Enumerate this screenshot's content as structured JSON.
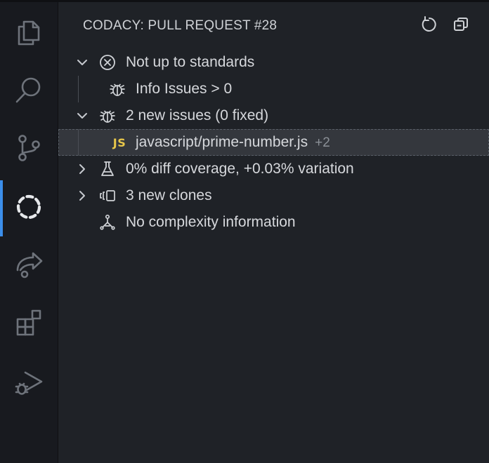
{
  "activity_bar": {
    "items": [
      {
        "name": "explorer",
        "icon": "files-icon"
      },
      {
        "name": "search",
        "icon": "search-icon"
      },
      {
        "name": "source-control",
        "icon": "source-control-icon"
      },
      {
        "name": "codacy",
        "icon": "codacy-icon",
        "active": true
      },
      {
        "name": "remote",
        "icon": "remote-share-icon"
      },
      {
        "name": "extensions",
        "icon": "extensions-icon"
      },
      {
        "name": "run-debug",
        "icon": "run-debug-icon"
      }
    ],
    "accent_color": "#3b8eea"
  },
  "panel": {
    "title": "CODACY: PULL REQUEST #28",
    "actions": [
      {
        "name": "refresh",
        "icon": "refresh-icon"
      },
      {
        "name": "collapse-all",
        "icon": "collapse-all-icon"
      }
    ]
  },
  "tree": {
    "rows": [
      {
        "label": "Not up to standards",
        "icon": "circle-x-icon",
        "expanded": true,
        "level": 0
      },
      {
        "label": "Info Issues > 0",
        "icon": "bug-icon",
        "level": 1
      },
      {
        "label": "2 new issues (0 fixed)",
        "icon": "bug-icon",
        "expanded": true,
        "level": 0
      },
      {
        "label": "javascript/prime-number.js",
        "badge": "JS",
        "description": "+2",
        "level": 1,
        "selected": true
      },
      {
        "label": "0% diff coverage, +0.03% variation",
        "icon": "beaker-icon",
        "expanded": false,
        "level": 0
      },
      {
        "label": "3 new clones",
        "icon": "clones-icon",
        "expanded": false,
        "level": 0
      },
      {
        "label": "No complexity information",
        "icon": "complexity-icon",
        "level": 0
      }
    ]
  },
  "colors": {
    "background": "#1f2227",
    "activity_bar": "#181a1f",
    "selection": "#34373d",
    "js_badge": "#e8c74a",
    "text": "#d6d8dc"
  }
}
